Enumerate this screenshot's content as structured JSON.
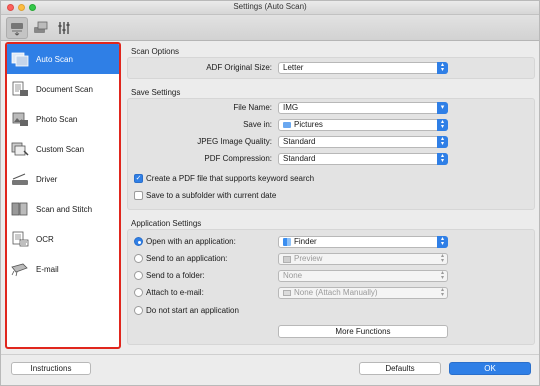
{
  "window": {
    "title": "Settings (Auto Scan)"
  },
  "toolbar": {
    "icons": [
      "scan-from-computer-icon",
      "scan-from-operation-panel-icon",
      "general-settings-icon"
    ]
  },
  "sidebar": {
    "items": [
      {
        "label": "Auto Scan",
        "icon": "auto-scan-icon",
        "selected": true
      },
      {
        "label": "Document Scan",
        "icon": "document-scan-icon",
        "selected": false
      },
      {
        "label": "Photo Scan",
        "icon": "photo-scan-icon",
        "selected": false
      },
      {
        "label": "Custom Scan",
        "icon": "custom-scan-icon",
        "selected": false
      },
      {
        "label": "Driver",
        "icon": "driver-icon",
        "selected": false
      },
      {
        "label": "Scan and Stitch",
        "icon": "scan-and-stitch-icon",
        "selected": false
      },
      {
        "label": "OCR",
        "icon": "ocr-icon",
        "selected": false
      },
      {
        "label": "E-mail",
        "icon": "email-icon",
        "selected": false
      }
    ]
  },
  "scan_options": {
    "title": "Scan Options",
    "adf_label": "ADF Original Size:",
    "adf_value": "Letter"
  },
  "save_settings": {
    "title": "Save Settings",
    "file_name_label": "File Name:",
    "file_name_value": "IMG",
    "save_in_label": "Save in:",
    "save_in_value": "Pictures",
    "jpeg_label": "JPEG Image Quality:",
    "jpeg_value": "Standard",
    "pdf_label": "PDF Compression:",
    "pdf_value": "Standard",
    "keyword_search_label": "Create a PDF file that supports keyword search",
    "keyword_search_checked": true,
    "subfolder_label": "Save to a subfolder with current date",
    "subfolder_checked": false
  },
  "application_settings": {
    "title": "Application Settings",
    "open_with_label": "Open with an application:",
    "open_with_value": "Finder",
    "send_app_label": "Send to an application:",
    "send_app_value": "Preview",
    "send_folder_label": "Send to a folder:",
    "send_folder_value": "None",
    "attach_email_label": "Attach to e-mail:",
    "attach_email_value": "None (Attach Manually)",
    "no_app_label": "Do not start an application",
    "more_functions_label": "More Functions"
  },
  "footer": {
    "instructions_label": "Instructions",
    "defaults_label": "Defaults",
    "ok_label": "OK"
  },
  "colors": {
    "accent": "#2f7fe6",
    "highlight_border": "#e0261d"
  }
}
